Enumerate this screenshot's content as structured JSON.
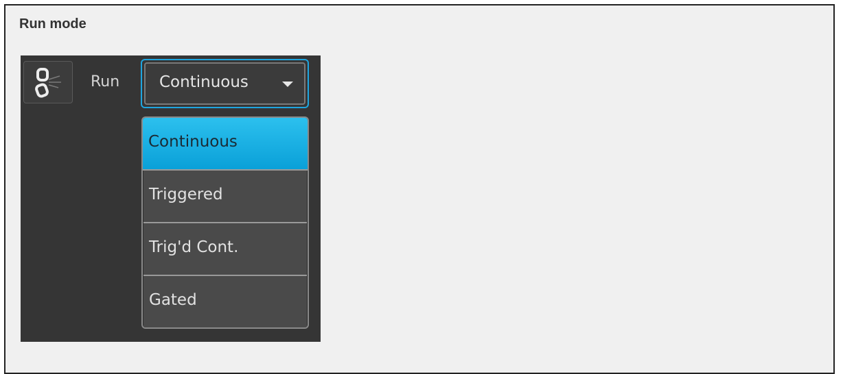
{
  "section": {
    "title": "Run mode"
  },
  "toolbar": {
    "link_icon": "chain-link-icon",
    "run_label": "Run"
  },
  "run_select": {
    "value": "Continuous",
    "options": [
      "Continuous",
      "Triggered",
      "Trig'd Cont.",
      "Gated"
    ],
    "selected_index": 0
  },
  "colors": {
    "panel_bg": "#353535",
    "focus_accent": "#1ea6e0",
    "selected_option": "#0aa0d8",
    "option_bg": "#4a4a4a",
    "page_bg": "#f0f0f0"
  }
}
